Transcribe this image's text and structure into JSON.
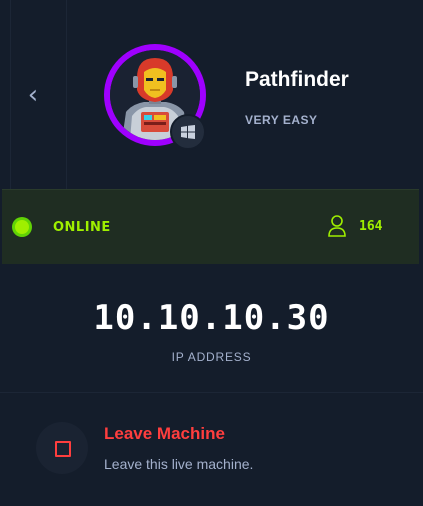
{
  "machine": {
    "name": "Pathfinder",
    "difficulty": "VERY EASY",
    "os_icon": "windows-icon",
    "avatar_ring_color": "#9f00ff"
  },
  "status": {
    "label": "ONLINE",
    "user_count": "164",
    "color": "#9fef00"
  },
  "connection": {
    "ip": "10.10.10.30",
    "ip_label": "IP ADDRESS"
  },
  "leave": {
    "title": "Leave Machine",
    "subtitle": "Leave this live machine.",
    "color": "#ff3e3e"
  },
  "nav": {
    "back_icon": "chevron-left-icon"
  }
}
